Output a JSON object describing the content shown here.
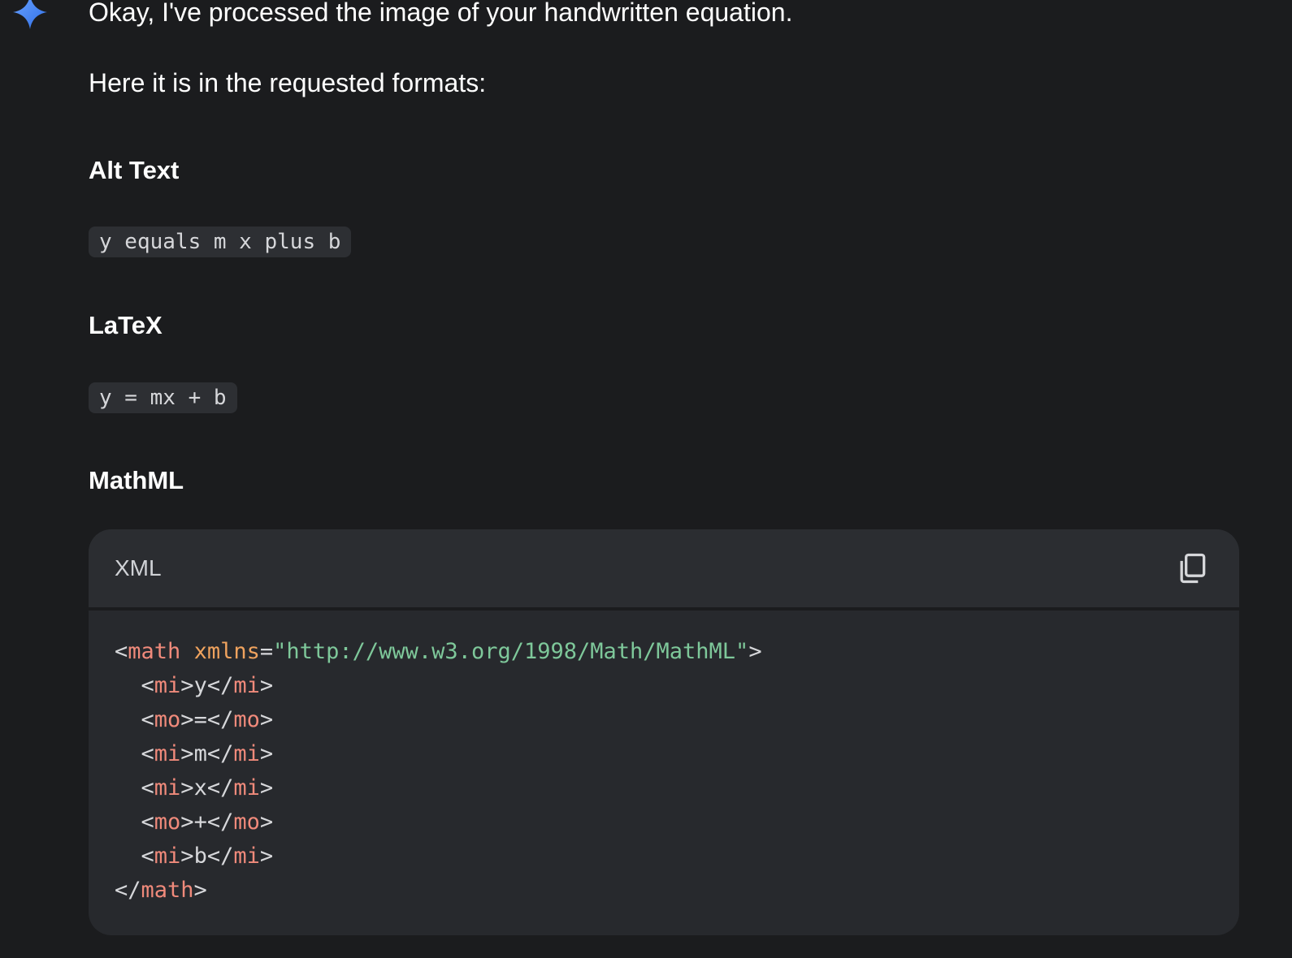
{
  "message": {
    "avatar_icon": "gemini-spark-icon",
    "paragraph_1": "Okay, I've processed the image of your handwritten equation.",
    "paragraph_2": "Here it is in the requested formats:",
    "sections": {
      "alt_text": {
        "heading": "Alt Text",
        "code": "y equals m x plus b"
      },
      "latex": {
        "heading": "LaTeX",
        "code": "y = mx + b"
      },
      "mathml": {
        "heading": "MathML",
        "code_block": {
          "language": "XML",
          "copy_icon": "copy-icon",
          "lines": [
            [
              {
                "t": "punct",
                "v": "<"
              },
              {
                "t": "tag",
                "v": "math"
              },
              {
                "t": "punct",
                "v": " "
              },
              {
                "t": "attr",
                "v": "xmlns"
              },
              {
                "t": "punct",
                "v": "="
              },
              {
                "t": "str",
                "v": "\"http://www.w3.org/1998/Math/MathML\""
              },
              {
                "t": "punct",
                "v": ">"
              }
            ],
            [
              {
                "t": "punct",
                "v": "  <"
              },
              {
                "t": "tag",
                "v": "mi"
              },
              {
                "t": "punct",
                "v": ">"
              },
              {
                "t": "text",
                "v": "y"
              },
              {
                "t": "punct",
                "v": "</"
              },
              {
                "t": "tag",
                "v": "mi"
              },
              {
                "t": "punct",
                "v": ">"
              }
            ],
            [
              {
                "t": "punct",
                "v": "  <"
              },
              {
                "t": "tag",
                "v": "mo"
              },
              {
                "t": "punct",
                "v": ">"
              },
              {
                "t": "text",
                "v": "="
              },
              {
                "t": "punct",
                "v": "</"
              },
              {
                "t": "tag",
                "v": "mo"
              },
              {
                "t": "punct",
                "v": ">"
              }
            ],
            [
              {
                "t": "punct",
                "v": "  <"
              },
              {
                "t": "tag",
                "v": "mi"
              },
              {
                "t": "punct",
                "v": ">"
              },
              {
                "t": "text",
                "v": "m"
              },
              {
                "t": "punct",
                "v": "</"
              },
              {
                "t": "tag",
                "v": "mi"
              },
              {
                "t": "punct",
                "v": ">"
              }
            ],
            [
              {
                "t": "punct",
                "v": "  <"
              },
              {
                "t": "tag",
                "v": "mi"
              },
              {
                "t": "punct",
                "v": ">"
              },
              {
                "t": "text",
                "v": "x"
              },
              {
                "t": "punct",
                "v": "</"
              },
              {
                "t": "tag",
                "v": "mi"
              },
              {
                "t": "punct",
                "v": ">"
              }
            ],
            [
              {
                "t": "punct",
                "v": "  <"
              },
              {
                "t": "tag",
                "v": "mo"
              },
              {
                "t": "punct",
                "v": ">"
              },
              {
                "t": "text",
                "v": "+"
              },
              {
                "t": "punct",
                "v": "</"
              },
              {
                "t": "tag",
                "v": "mo"
              },
              {
                "t": "punct",
                "v": ">"
              }
            ],
            [
              {
                "t": "punct",
                "v": "  <"
              },
              {
                "t": "tag",
                "v": "mi"
              },
              {
                "t": "punct",
                "v": ">"
              },
              {
                "t": "text",
                "v": "b"
              },
              {
                "t": "punct",
                "v": "</"
              },
              {
                "t": "tag",
                "v": "mi"
              },
              {
                "t": "punct",
                "v": ">"
              }
            ],
            [
              {
                "t": "punct",
                "v": "</"
              },
              {
                "t": "tag",
                "v": "math"
              },
              {
                "t": "punct",
                "v": ">"
              }
            ]
          ]
        }
      }
    }
  },
  "colors": {
    "background": "#1b1c1e",
    "code_block_bg": "#27292d",
    "code_header_bg": "#2b2d31",
    "inline_code_bg": "#2d2f33",
    "tag": "#f08a7b",
    "attr": "#f0a35e",
    "string": "#7ec89a",
    "spark_blue": "#4a8bf5"
  }
}
